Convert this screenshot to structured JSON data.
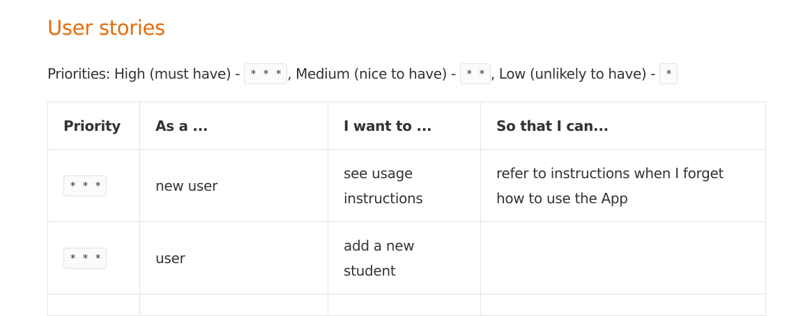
{
  "heading": "User stories",
  "priorities_line": {
    "lead": "Priorities: High (must have) - ",
    "high_code": "* * *",
    "medium_text": ", Medium (nice to have) - ",
    "medium_code": "* *",
    "low_text": ", Low (unlikely to have) - ",
    "low_code": "*"
  },
  "table": {
    "headers": [
      "Priority",
      "As a ...",
      "I want to ...",
      "So that I can..."
    ],
    "rows": [
      {
        "priority": "* * *",
        "role": "new user",
        "want": "see usage instructions",
        "benefit": "refer to instructions when I forget how to use the App"
      },
      {
        "priority": "* * *",
        "role": "user",
        "want": "add a new student",
        "benefit": ""
      }
    ]
  },
  "colors": {
    "heading": "#e46c0a",
    "text": "#333333",
    "border": "#e3e3e3"
  }
}
